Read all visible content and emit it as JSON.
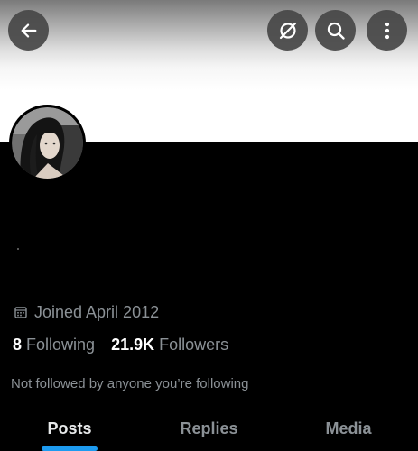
{
  "header": {
    "back_icon": "arrow-left-icon",
    "grok_icon": "grok-icon",
    "search_icon": "search-icon",
    "more_icon": "more-vertical-icon"
  },
  "profile": {
    "avatar_alt": "avatar",
    "joined_icon": "calendar-icon",
    "joined_text": "Joined April 2012",
    "following_count": "8",
    "following_label": "Following",
    "followers_count": "21.9K",
    "followers_label": "Followers",
    "not_followed_text": "Not followed by anyone you’re following"
  },
  "tabs": [
    {
      "label": "Posts",
      "active": true
    },
    {
      "label": "Replies",
      "active": false
    },
    {
      "label": "Media",
      "active": false
    }
  ],
  "colors": {
    "accent": "#1d9bf0",
    "background": "#000000",
    "muted_text": "#8b9196",
    "primary_text": "#ffffff"
  }
}
